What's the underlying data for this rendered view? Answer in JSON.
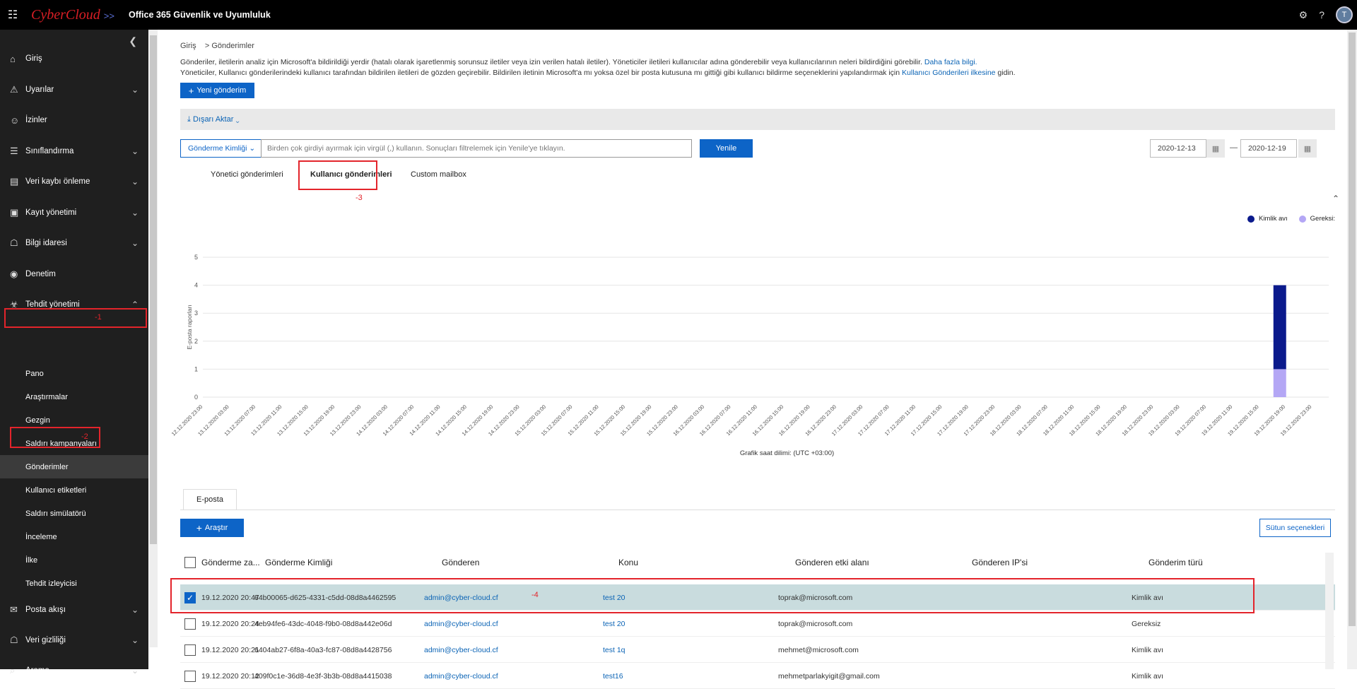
{
  "topbar": {
    "logo_text": "CyberCloud",
    "logo_arrows": ">>",
    "app_title": "Office 365 Güvenlik ve Uyumluluk",
    "avatar_initial": "T"
  },
  "sidebar": {
    "items": [
      {
        "label": "Giriş",
        "icon": "home-icon",
        "chevron": false
      },
      {
        "label": "Uyarılar",
        "icon": "warning-icon",
        "chevron": true
      },
      {
        "label": "İzinler",
        "icon": "people-icon",
        "chevron": false
      },
      {
        "label": "Sınıflandırma",
        "icon": "list-icon",
        "chevron": true
      },
      {
        "label": "Veri kaybı önleme",
        "icon": "document-lock-icon",
        "chevron": true
      },
      {
        "label": "Kayıt yönetimi",
        "icon": "records-icon",
        "chevron": true
      },
      {
        "label": "Bilgi idaresi",
        "icon": "lock-icon",
        "chevron": true
      },
      {
        "label": "Denetim",
        "icon": "eye-icon",
        "chevron": false
      },
      {
        "label": "Tehdit yönetimi",
        "icon": "biohazard-icon",
        "chevron": true
      }
    ],
    "sub_items": [
      "Pano",
      "Araştırmalar",
      "Gezgin",
      "Saldırı kampanyaları",
      "Gönderimler",
      "Kullanıcı etiketleri",
      "Saldırı simülatörü",
      "İnceleme",
      "İlke",
      "Tehdit izleyicisi"
    ],
    "bottom_items": [
      {
        "label": "Posta akışı",
        "icon": "mail-icon"
      },
      {
        "label": "Veri gizliliği",
        "icon": "lock-icon"
      },
      {
        "label": "Arama",
        "icon": "search-icon"
      }
    ]
  },
  "annotations": {
    "a1": "-1",
    "a2": "-2",
    "a3": "-3",
    "a4": "-4"
  },
  "breadcrumb": {
    "home": "Giriş",
    "sep": ">",
    "current": "Gönderimler"
  },
  "description": {
    "line1": "Gönderiler, iletilerin analiz için Microsoft'a bildirildiği yerdir (hatalı olarak işaretlenmiş sorunsuz iletiler veya izin verilen hatalı iletiler). Yöneticiler iletileri kullanıcılar adına gönderebilir veya kullanıcılarının neleri bildirdiğini görebilir. ",
    "line1_link": "Daha fazla bilgi.",
    "line2": "Yöneticiler, Kullanıcı gönderilerindeki kullanıcı tarafından bildirilen iletileri de gözden geçirebilir. Bildirilen iletinin Microsoft'a mı yoksa özel bir posta kutusuna mı gittiği gibi kullanıcı bildirme seçeneklerini yapılandırmak için ",
    "line2_link": "Kullanıcı Gönderileri ilkesine",
    "line2_end": " gidin."
  },
  "new_submission_button": "Yeni gönderim",
  "export_label": "Dışarı Aktar",
  "filter": {
    "dropdown_label": "Gönderme Kimliği",
    "input_placeholder": "Birden çok girdiyi ayırmak için virgül (,) kullanın. Sonuçları filtrelemek için Yenile'ye tıklayın.",
    "refresh_button": "Yenile",
    "date_from": "2020-12-13",
    "date_sep": "—",
    "date_to": "2020-12-19"
  },
  "tabs": [
    "Yönetici gönderimleri",
    "Kullanıcı gönderimleri",
    "Custom mailbox"
  ],
  "active_tab": 1,
  "chart_data": {
    "type": "bar",
    "ylabel": "E-posta raporları",
    "xlabel": "Grafik saat dilimi: (UTC +03:00)",
    "ylim": [
      0,
      5
    ],
    "yticks": [
      0,
      1,
      2,
      3,
      4,
      5
    ],
    "categories": [
      "12.12.2020 23:00",
      "13.12.2020 03:00",
      "13.12.2020 07:00",
      "13.12.2020 11:00",
      "13.12.2020 15:00",
      "13.12.2020 19:00",
      "13.12.2020 23:00",
      "14.12.2020 03:00",
      "14.12.2020 07:00",
      "14.12.2020 11:00",
      "14.12.2020 15:00",
      "14.12.2020 19:00",
      "14.12.2020 23:00",
      "15.12.2020 03:00",
      "15.12.2020 07:00",
      "15.12.2020 11:00",
      "15.12.2020 15:00",
      "15.12.2020 19:00",
      "15.12.2020 23:00",
      "16.12.2020 03:00",
      "16.12.2020 07:00",
      "16.12.2020 11:00",
      "16.12.2020 15:00",
      "16.12.2020 19:00",
      "16.12.2020 23:00",
      "17.12.2020 03:00",
      "17.12.2020 07:00",
      "17.12.2020 11:00",
      "17.12.2020 15:00",
      "17.12.2020 19:00",
      "17.12.2020 23:00",
      "18.12.2020 03:00",
      "18.12.2020 07:00",
      "18.12.2020 11:00",
      "18.12.2020 15:00",
      "18.12.2020 19:00",
      "18.12.2020 23:00",
      "19.12.2020 03:00",
      "19.12.2020 07:00",
      "19.12.2020 11:00",
      "19.12.2020 15:00",
      "19.12.2020 19:00",
      "19.12.2020 23:00"
    ],
    "series": [
      {
        "name": "Kimlik avı",
        "color": "#0b1a8c",
        "values": [
          0,
          0,
          0,
          0,
          0,
          0,
          0,
          0,
          0,
          0,
          0,
          0,
          0,
          0,
          0,
          0,
          0,
          0,
          0,
          0,
          0,
          0,
          0,
          0,
          0,
          0,
          0,
          0,
          0,
          0,
          0,
          0,
          0,
          0,
          0,
          0,
          0,
          0,
          0,
          0,
          0,
          3,
          0
        ]
      },
      {
        "name": "Gereksiz",
        "color": "#b4a7f5",
        "values": [
          0,
          0,
          0,
          0,
          0,
          0,
          0,
          0,
          0,
          0,
          0,
          0,
          0,
          0,
          0,
          0,
          0,
          0,
          0,
          0,
          0,
          0,
          0,
          0,
          0,
          0,
          0,
          0,
          0,
          0,
          0,
          0,
          0,
          0,
          0,
          0,
          0,
          0,
          0,
          0,
          0,
          1,
          0
        ]
      }
    ],
    "legend_position": "top-right",
    "legend_labels": [
      "Kimlik avı",
      "Gereksi:"
    ]
  },
  "email_tab": "E-posta",
  "investigate_button": "Araştır",
  "column_options_button": "Sütun seçenekleri",
  "table": {
    "columns": [
      "Gönderme za...",
      "Gönderme Kimliği",
      "Gönderen",
      "Konu",
      "Gönderen etki alanı",
      "Gönderen IP'si",
      "Gönderim türü"
    ],
    "rows": [
      {
        "date": "19.12.2020 20:47",
        "id": "64b00065-d625-4331-c5dd-08d8a4462595",
        "sender": "admin@cyber-cloud.cf",
        "subject": "test 20",
        "domain": "toprak@microsoft.com",
        "ip": "",
        "type": "Kimlik avı",
        "checked": true
      },
      {
        "date": "19.12.2020 20:24",
        "id": "4eb94fe6-43dc-4048-f9b0-08d8a442e06d",
        "sender": "admin@cyber-cloud.cf",
        "subject": "test 20",
        "domain": "toprak@microsoft.com",
        "ip": "",
        "type": "Gereksiz",
        "checked": false
      },
      {
        "date": "19.12.2020 20:21",
        "id": "6404ab27-6f8a-40a3-fc87-08d8a4428756",
        "sender": "admin@cyber-cloud.cf",
        "subject": "test 1q",
        "domain": "mehmet@microsoft.com",
        "ip": "",
        "type": "Kimlik avı",
        "checked": false
      },
      {
        "date": "19.12.2020 20:12",
        "id": "409f0c1e-36d8-4e3f-3b3b-08d8a4415038",
        "sender": "admin@cyber-cloud.cf",
        "subject": "test16",
        "domain": "mehmetparlakyigit@gmail.com",
        "ip": "",
        "type": "Kimlik avı",
        "checked": false
      }
    ]
  }
}
